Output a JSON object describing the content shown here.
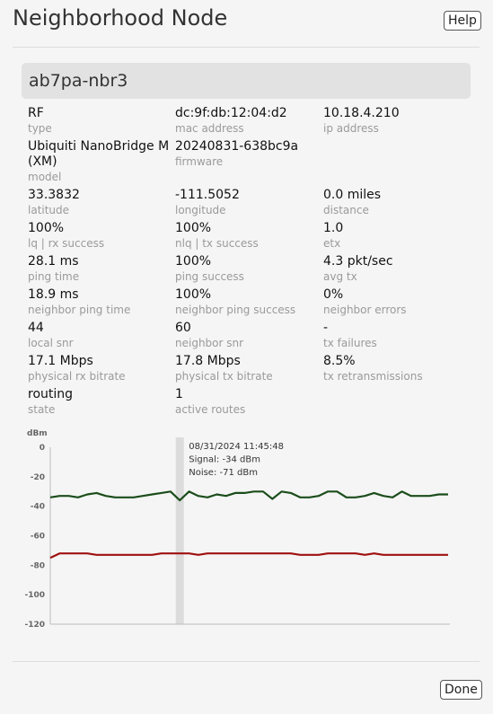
{
  "dialog": {
    "title": "Neighborhood Node",
    "help_label": "Help",
    "done_label": "Done"
  },
  "node": {
    "name": "ab7pa-nbr3"
  },
  "fields": [
    [
      {
        "value": "RF",
        "label": "type"
      },
      {
        "value": "dc:9f:db:12:04:d2",
        "label": "mac address"
      },
      {
        "value": "10.18.4.210",
        "label": "ip address"
      }
    ],
    [
      {
        "value": "Ubiquiti NanoBridge M (XM)",
        "label": "model"
      },
      {
        "value": "20240831-638bc9a",
        "label": "firmware"
      },
      {
        "value": "",
        "label": ""
      }
    ],
    [
      {
        "value": "33.3832",
        "label": "latitude"
      },
      {
        "value": "-111.5052",
        "label": "longitude"
      },
      {
        "value": "0.0 miles",
        "label": "distance"
      }
    ],
    [
      {
        "value": "100%",
        "label": "lq | rx success"
      },
      {
        "value": "100%",
        "label": "nlq | tx success"
      },
      {
        "value": "1.0",
        "label": "etx"
      }
    ],
    [
      {
        "value": "28.1 ms",
        "label": "ping time"
      },
      {
        "value": "100%",
        "label": "ping success"
      },
      {
        "value": "4.3 pkt/sec",
        "label": "avg tx"
      }
    ],
    [
      {
        "value": "18.9 ms",
        "label": "neighbor ping time"
      },
      {
        "value": "100%",
        "label": "neighbor ping success"
      },
      {
        "value": "0%",
        "label": "neighbor errors"
      }
    ],
    [
      {
        "value": "44",
        "label": "local snr"
      },
      {
        "value": "60",
        "label": "neighbor snr"
      },
      {
        "value": "-",
        "label": "tx failures"
      }
    ],
    [
      {
        "value": "17.1 Mbps",
        "label": "physical rx bitrate"
      },
      {
        "value": "17.8 Mbps",
        "label": "physical tx bitrate"
      },
      {
        "value": "8.5%",
        "label": "tx retransmissions"
      }
    ],
    [
      {
        "value": "routing",
        "label": "state"
      },
      {
        "value": "1",
        "label": "active routes"
      },
      {
        "value": "",
        "label": ""
      }
    ]
  ],
  "chart_data": {
    "type": "line",
    "ylabel": "dBm",
    "ylim": [
      -120,
      0
    ],
    "yticks": [
      0,
      -20,
      -40,
      -60,
      -80,
      -100,
      -120
    ],
    "ytick_labels": [
      "0",
      "-20",
      "-40",
      "-60",
      "-80",
      "-100",
      "-120"
    ],
    "series": [
      {
        "color": "#1b4d1b",
        "values": [
          -34,
          -33,
          -33,
          -34,
          -32,
          -31,
          -33,
          -34,
          -34,
          -34,
          -33,
          -32,
          -31,
          -30,
          -36,
          -30,
          -33,
          -34,
          -32,
          -33,
          -31,
          -31,
          -30,
          -30,
          -35,
          -30,
          -31,
          -34,
          -34,
          -33,
          -30,
          -30,
          -34,
          -34,
          -33,
          -31,
          -33,
          -34,
          -30,
          -33,
          -33,
          -33,
          -32,
          -32
        ]
      },
      {
        "color": "#a01010",
        "values": [
          -75,
          -72,
          -72,
          -72,
          -72,
          -73,
          -73,
          -73,
          -73,
          -73,
          -73,
          -73,
          -72,
          -72,
          -72,
          -72,
          -73,
          -72,
          -72,
          -72,
          -72,
          -72,
          -72,
          -72,
          -72,
          -72,
          -72,
          -73,
          -73,
          -73,
          -72,
          -72,
          -72,
          -72,
          -73,
          -72,
          -73,
          -73,
          -73,
          -73,
          -73,
          -73,
          -73,
          -73
        ]
      }
    ],
    "hover": {
      "index": 14,
      "lines": [
        "08/31/2024 11:45:48",
        "Signal: -34 dBm",
        "Noise: -71 dBm"
      ]
    }
  }
}
